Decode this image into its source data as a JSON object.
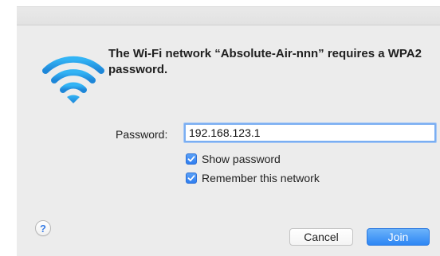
{
  "dialog": {
    "message": "The Wi-Fi network “Absolute-Air-nnn” requires a WPA2 password.",
    "icon": "wifi-icon"
  },
  "password": {
    "label": "Password:",
    "value": "192.168.123.1"
  },
  "options": {
    "show_password": {
      "label": "Show password",
      "checked": true
    },
    "remember_network": {
      "label": "Remember this network",
      "checked": true
    }
  },
  "buttons": {
    "help_label": "?",
    "cancel_label": "Cancel",
    "join_label": "Join"
  },
  "colors": {
    "accent": "#2f7ef0",
    "wifi_icon": "#2a9ae6",
    "background": "#ececec"
  }
}
